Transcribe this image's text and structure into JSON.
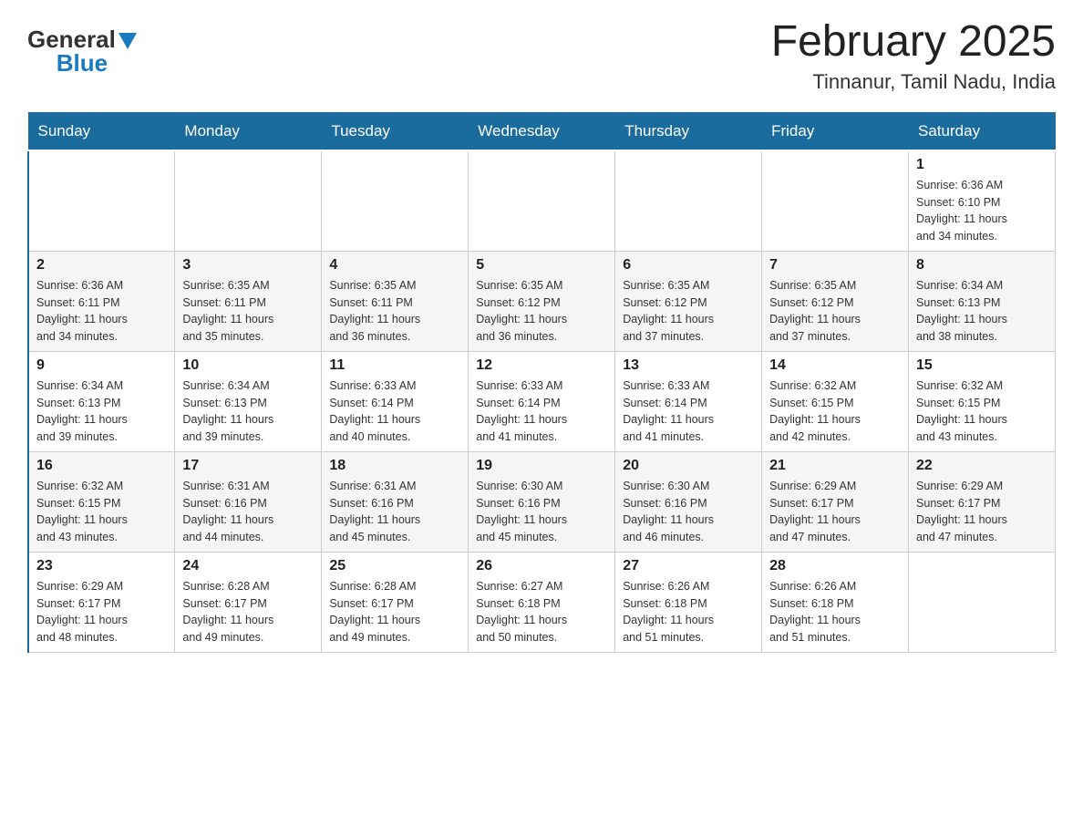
{
  "header": {
    "logo_general": "General",
    "logo_blue": "Blue",
    "month_year": "February 2025",
    "location": "Tinnanur, Tamil Nadu, India"
  },
  "days_of_week": [
    "Sunday",
    "Monday",
    "Tuesday",
    "Wednesday",
    "Thursday",
    "Friday",
    "Saturday"
  ],
  "weeks": [
    {
      "days": [
        {
          "number": "",
          "info": ""
        },
        {
          "number": "",
          "info": ""
        },
        {
          "number": "",
          "info": ""
        },
        {
          "number": "",
          "info": ""
        },
        {
          "number": "",
          "info": ""
        },
        {
          "number": "",
          "info": ""
        },
        {
          "number": "1",
          "info": "Sunrise: 6:36 AM\nSunset: 6:10 PM\nDaylight: 11 hours\nand 34 minutes."
        }
      ]
    },
    {
      "days": [
        {
          "number": "2",
          "info": "Sunrise: 6:36 AM\nSunset: 6:11 PM\nDaylight: 11 hours\nand 34 minutes."
        },
        {
          "number": "3",
          "info": "Sunrise: 6:35 AM\nSunset: 6:11 PM\nDaylight: 11 hours\nand 35 minutes."
        },
        {
          "number": "4",
          "info": "Sunrise: 6:35 AM\nSunset: 6:11 PM\nDaylight: 11 hours\nand 36 minutes."
        },
        {
          "number": "5",
          "info": "Sunrise: 6:35 AM\nSunset: 6:12 PM\nDaylight: 11 hours\nand 36 minutes."
        },
        {
          "number": "6",
          "info": "Sunrise: 6:35 AM\nSunset: 6:12 PM\nDaylight: 11 hours\nand 37 minutes."
        },
        {
          "number": "7",
          "info": "Sunrise: 6:35 AM\nSunset: 6:12 PM\nDaylight: 11 hours\nand 37 minutes."
        },
        {
          "number": "8",
          "info": "Sunrise: 6:34 AM\nSunset: 6:13 PM\nDaylight: 11 hours\nand 38 minutes."
        }
      ]
    },
    {
      "days": [
        {
          "number": "9",
          "info": "Sunrise: 6:34 AM\nSunset: 6:13 PM\nDaylight: 11 hours\nand 39 minutes."
        },
        {
          "number": "10",
          "info": "Sunrise: 6:34 AM\nSunset: 6:13 PM\nDaylight: 11 hours\nand 39 minutes."
        },
        {
          "number": "11",
          "info": "Sunrise: 6:33 AM\nSunset: 6:14 PM\nDaylight: 11 hours\nand 40 minutes."
        },
        {
          "number": "12",
          "info": "Sunrise: 6:33 AM\nSunset: 6:14 PM\nDaylight: 11 hours\nand 41 minutes."
        },
        {
          "number": "13",
          "info": "Sunrise: 6:33 AM\nSunset: 6:14 PM\nDaylight: 11 hours\nand 41 minutes."
        },
        {
          "number": "14",
          "info": "Sunrise: 6:32 AM\nSunset: 6:15 PM\nDaylight: 11 hours\nand 42 minutes."
        },
        {
          "number": "15",
          "info": "Sunrise: 6:32 AM\nSunset: 6:15 PM\nDaylight: 11 hours\nand 43 minutes."
        }
      ]
    },
    {
      "days": [
        {
          "number": "16",
          "info": "Sunrise: 6:32 AM\nSunset: 6:15 PM\nDaylight: 11 hours\nand 43 minutes."
        },
        {
          "number": "17",
          "info": "Sunrise: 6:31 AM\nSunset: 6:16 PM\nDaylight: 11 hours\nand 44 minutes."
        },
        {
          "number": "18",
          "info": "Sunrise: 6:31 AM\nSunset: 6:16 PM\nDaylight: 11 hours\nand 45 minutes."
        },
        {
          "number": "19",
          "info": "Sunrise: 6:30 AM\nSunset: 6:16 PM\nDaylight: 11 hours\nand 45 minutes."
        },
        {
          "number": "20",
          "info": "Sunrise: 6:30 AM\nSunset: 6:16 PM\nDaylight: 11 hours\nand 46 minutes."
        },
        {
          "number": "21",
          "info": "Sunrise: 6:29 AM\nSunset: 6:17 PM\nDaylight: 11 hours\nand 47 minutes."
        },
        {
          "number": "22",
          "info": "Sunrise: 6:29 AM\nSunset: 6:17 PM\nDaylight: 11 hours\nand 47 minutes."
        }
      ]
    },
    {
      "days": [
        {
          "number": "23",
          "info": "Sunrise: 6:29 AM\nSunset: 6:17 PM\nDaylight: 11 hours\nand 48 minutes."
        },
        {
          "number": "24",
          "info": "Sunrise: 6:28 AM\nSunset: 6:17 PM\nDaylight: 11 hours\nand 49 minutes."
        },
        {
          "number": "25",
          "info": "Sunrise: 6:28 AM\nSunset: 6:17 PM\nDaylight: 11 hours\nand 49 minutes."
        },
        {
          "number": "26",
          "info": "Sunrise: 6:27 AM\nSunset: 6:18 PM\nDaylight: 11 hours\nand 50 minutes."
        },
        {
          "number": "27",
          "info": "Sunrise: 6:26 AM\nSunset: 6:18 PM\nDaylight: 11 hours\nand 51 minutes."
        },
        {
          "number": "28",
          "info": "Sunrise: 6:26 AM\nSunset: 6:18 PM\nDaylight: 11 hours\nand 51 minutes."
        },
        {
          "number": "",
          "info": ""
        }
      ]
    }
  ]
}
